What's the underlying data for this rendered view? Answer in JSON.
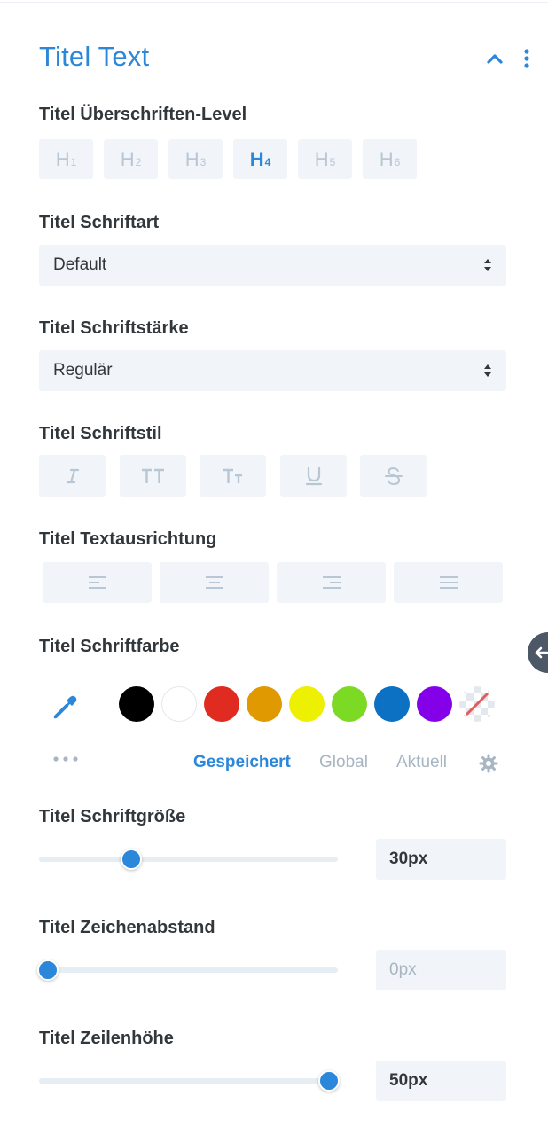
{
  "section": {
    "title": "Titel Text"
  },
  "heading_level": {
    "label": "Titel Überschriften-Level",
    "options": [
      {
        "main": "H",
        "sub": "1"
      },
      {
        "main": "H",
        "sub": "2"
      },
      {
        "main": "H",
        "sub": "3"
      },
      {
        "main": "H",
        "sub": "4"
      },
      {
        "main": "H",
        "sub": "5"
      },
      {
        "main": "H",
        "sub": "6"
      }
    ],
    "selected": "H4"
  },
  "font": {
    "label": "Titel Schriftart",
    "value": "Default"
  },
  "weight": {
    "label": "Titel Schriftstärke",
    "value": "Regulär"
  },
  "style": {
    "label": "Titel Schriftstil",
    "options": [
      "italic",
      "uppercase",
      "capitalize",
      "underline",
      "strikethrough"
    ]
  },
  "alignment": {
    "label": "Titel Textausrichtung",
    "options": [
      "left",
      "center",
      "right",
      "justify"
    ]
  },
  "color": {
    "label": "Titel Schriftfarbe",
    "swatches": [
      "#000000",
      "#ffffff",
      "#e02b20",
      "#e09900",
      "#edf000",
      "#7cda24",
      "#0c71c3",
      "#8300e9",
      "none"
    ],
    "tabs": [
      "Gespeichert",
      "Global",
      "Aktuell"
    ],
    "active_tab": "Gespeichert"
  },
  "size": {
    "label": "Titel Schriftgröße",
    "value": "30px",
    "level": 0.31
  },
  "letter_spacing": {
    "label": "Titel Zeichenabstand",
    "value": "0px",
    "level": 0.0
  },
  "line_height": {
    "label": "Titel Zeilenhöhe",
    "value": "50px",
    "level": 0.97
  },
  "colors": {
    "accent": "#2b87da",
    "muted": "#b9c6d3",
    "field_bg": "#f1f5f9"
  }
}
